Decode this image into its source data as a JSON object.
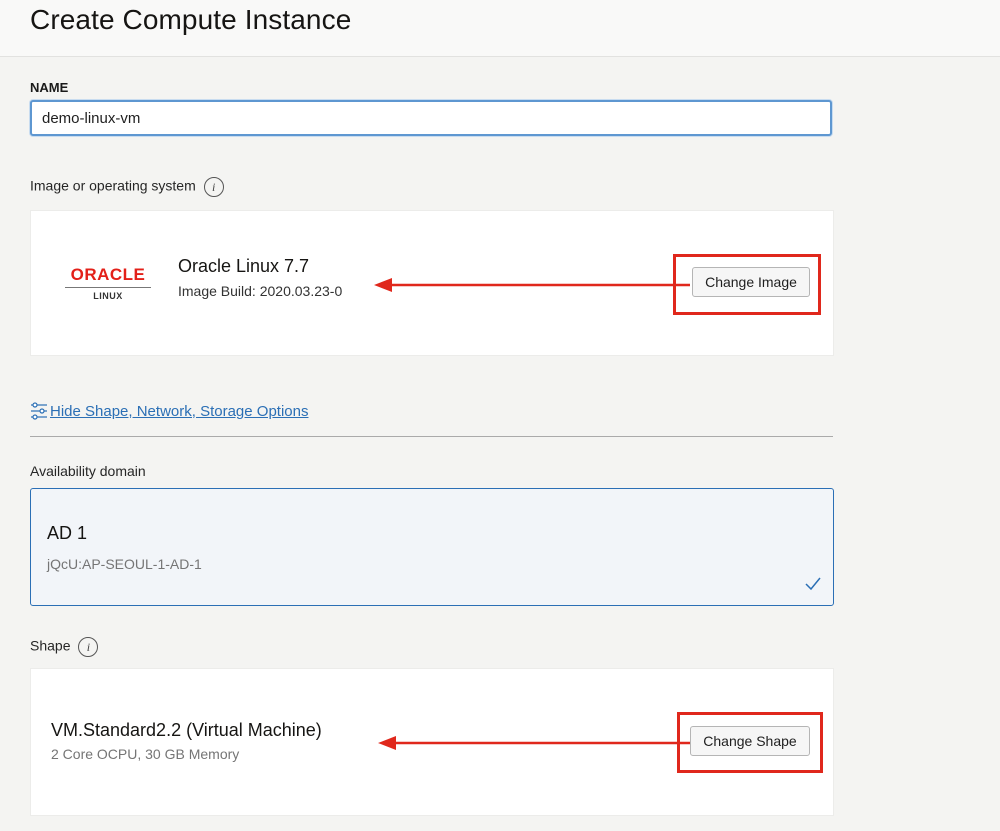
{
  "header": {
    "title": "Create Compute Instance"
  },
  "name_field": {
    "label": "NAME",
    "value": "demo-linux-vm"
  },
  "image_section": {
    "label": "Image or operating system",
    "info_icon": "info-icon",
    "logo": {
      "brand": "ORACLE",
      "product": "LINUX"
    },
    "os_name": "Oracle Linux 7.7",
    "build": "Image Build: 2020.03.23-0",
    "change_button": "Change Image"
  },
  "options_toggle": {
    "label": "Hide Shape, Network, Storage Options",
    "icon": "sliders-icon"
  },
  "availability": {
    "label": "Availability domain",
    "name": "AD 1",
    "id": "jQcU:AP-SEOUL-1-AD-1",
    "selected_icon": "checkmark-icon"
  },
  "shape_section": {
    "label": "Shape",
    "info_icon": "info-icon",
    "name": "VM.Standard2.2 (Virtual Machine)",
    "details": "2 Core OCPU, 30 GB Memory",
    "change_button": "Change Shape"
  },
  "annotations": {
    "color": "#e0281c"
  }
}
